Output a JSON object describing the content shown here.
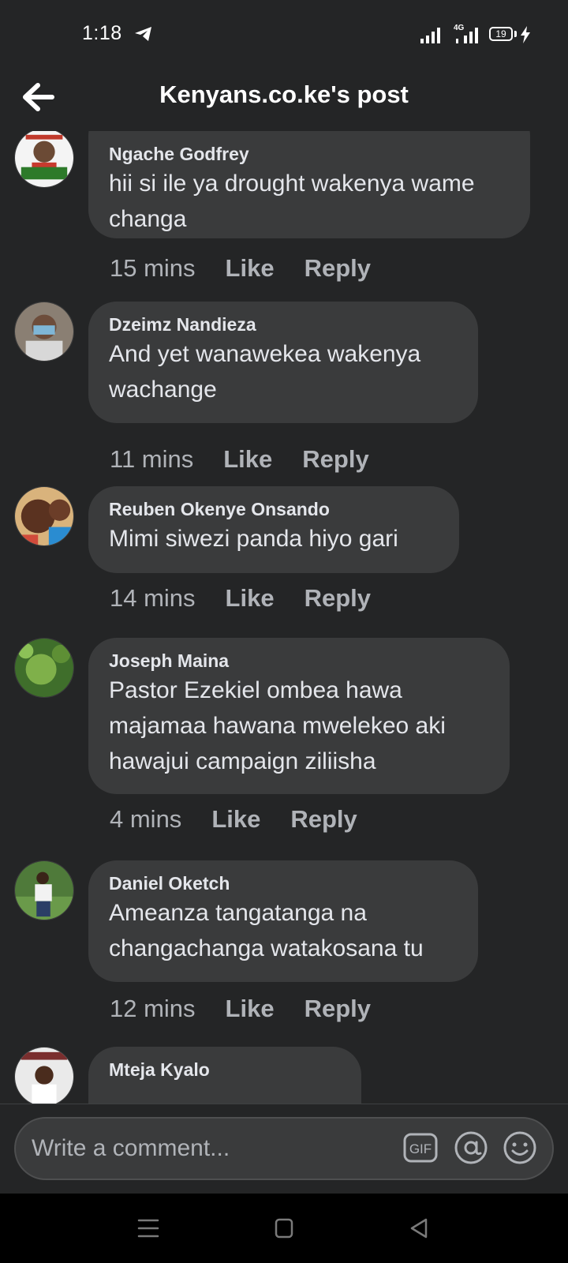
{
  "status_bar": {
    "time": "1:18",
    "network": "4G",
    "battery": "19",
    "icons": [
      "telegram-icon",
      "signal-icon",
      "signal-4g-icon",
      "battery-icon",
      "charging-icon"
    ]
  },
  "header": {
    "title": "Kenyans.co.ke's post",
    "back_icon": "arrow-left-icon"
  },
  "comments": [
    {
      "author": "Ngache Godfrey",
      "text": "hii si ile ya drought wakenya wame\nchanga",
      "time": "15 mins",
      "like": "Like",
      "reply": "Reply"
    },
    {
      "author": "Dzeimz Nandieza",
      "text": "And yet wanawekea wakenya\nwachange",
      "time": "11 mins",
      "like": "Like",
      "reply": "Reply"
    },
    {
      "author": "Reuben Okenye Onsando",
      "text": "Mimi siwezi panda hiyo gari",
      "time": "14 mins",
      "like": "Like",
      "reply": "Reply"
    },
    {
      "author": "Joseph Maina",
      "text": "Pastor Ezekiel ombea hawa\nmajamaa hawana mwelekeo aki\nhawajui campaign ziliisha",
      "time": "4 mins",
      "like": "Like",
      "reply": "Reply"
    },
    {
      "author": "Daniel Oketch",
      "text": "Ameanza tangatanga na\nchangachanga watakosana tu",
      "time": "12 mins",
      "like": "Like",
      "reply": "Reply"
    },
    {
      "author": "Mteja Kyalo",
      "text": "",
      "time": "",
      "like": "",
      "reply": ""
    }
  ],
  "composer": {
    "placeholder": "Write a comment...",
    "icons": [
      "gif-icon",
      "at-icon",
      "emoji-icon"
    ]
  },
  "nav_bar": {
    "icons": [
      "menu-icon",
      "home-icon",
      "back-triangle-icon"
    ]
  }
}
